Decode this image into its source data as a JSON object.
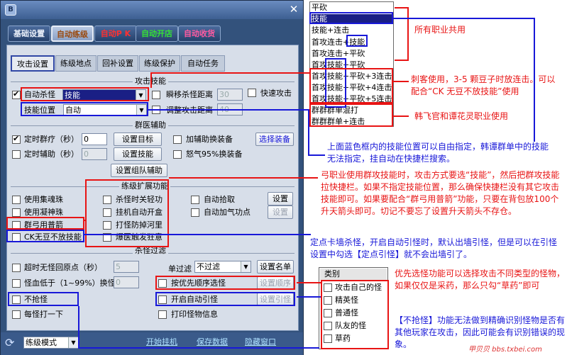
{
  "window": {
    "close_icon": "✕",
    "app_icon": "B"
  },
  "nav": [
    "基础设置",
    "自动练级",
    "自动P K",
    "自动开店",
    "自动收货"
  ],
  "nav_colors": [
    "#e8eef8",
    "#f0b060",
    "#ff3030",
    "#35e035",
    "#ff5aa0"
  ],
  "subtabs": [
    "攻击设置",
    "练级地点",
    "回补设置",
    "练级保护",
    "自动任务"
  ],
  "sections": {
    "attack_skill": "攻击技能",
    "group_assist": "群医辅助",
    "leveling_ext": "练级扩展功能",
    "monster_filter": "杀怪过滤"
  },
  "attack": {
    "auto_kill": "自动杀怪",
    "skill_value": "技能",
    "skill_position": "技能位置",
    "position_value": "自动",
    "shift_dist": "瞬移杀怪距离",
    "shift_dist_value": "30",
    "quick_attack": "快速攻击",
    "adjust_dist": "调整攻击距离",
    "adjust_dist_value": "40"
  },
  "group": {
    "timed_group": "定时群疗（秒）",
    "timed_group_value": "0",
    "set_target": "设置目标",
    "add_aux": "加辅助换装备",
    "select_equip": "选择装备",
    "timed_aux": "定时辅助（秒）",
    "timed_aux_value": "0",
    "set_skill": "设置技能",
    "rage": "怒气95%换装备",
    "set_party_aux": "设置组队辅助"
  },
  "ext": {
    "use_soul": "使用集魂珠",
    "kill_skill": "杀怪时关轻功",
    "auto_pick": "自动拾取",
    "settings": "设置",
    "use_ning": "使用凝神珠",
    "auto_gold": "挂机自动开盒",
    "auto_points": "自动加气功点",
    "settings2": "设置",
    "group_arrow": "群弓用普箭",
    "fight_river": "打怪防掉河里",
    "ck_skill": "CK无豆不放技能",
    "rage_burst": "爆医触发狂意"
  },
  "filter": {
    "timeout_return": "超时无怪回原点（秒）",
    "timeout_value": "5",
    "name_filter": "单过滤",
    "filter_value": "不过滤",
    "set_names": "设置名单",
    "hp_low": "怪血低于（1~99%）换怪",
    "hp_low_value": "0",
    "priority_select": "按优先顺序选怪",
    "set_order": "设置顺序",
    "no_pick": "不抢怪",
    "auto_lure": "开启自动引怪",
    "set_lure": "设置引怪",
    "each_hit": "每怪打一下",
    "print_info": "打印怪物信息"
  },
  "bottom": {
    "mode": "练级模式",
    "start": "开始挂机",
    "save": "保存数据",
    "hide": "隐藏窗口"
  },
  "skill_list": [
    "平砍",
    "技能",
    "技能+连击",
    "首攻连击+技能",
    "首攻连击+平砍",
    "首攻技能+平砍",
    "首攻技能+平砍+3连击",
    "首攻技能+平砍+4连击",
    "首攻技能+平砍+5连击",
    "群群群单混打",
    "群群群单+连击"
  ],
  "monster_list": {
    "header": "类别",
    "items": [
      "攻击自己的怪",
      "精英怪",
      "普通怪",
      "队友的怪",
      "草药"
    ]
  },
  "notes": {
    "all_classes": "所有职业共用",
    "assassin": "刺客使用，3-5 颗豆子时放连击。可以配合“CK 无豆不放技能”使用",
    "han_tan": "韩飞官和谭花灵职业使用",
    "blue_box": "上面蓝色框内的技能位置可以自由指定，韩谭群单中的技能无法指定，挂自动在快捷栏搜索。",
    "bow": "弓职业使用群攻技能时，攻击方式要选“技能”，然后把群攻技能拉快捷栏。如果不指定技能位置，那么确保快捷栏没有其它攻击技能即可。如果要配合“群弓用普箭”功能，只要在背包放100个升天箭头即可。切记不要忘了设置升天箭头不存仓。",
    "lure": "定点卡墙杀怪，开启自动引怪时，默认出墙引怪，但是可以在引怪设置中勾选【定点引怪】就不会出墙引了。",
    "priority": "优先选怪功能可以选择攻击不同类型的怪物，如果仅仅是采药，那么只勾“草药”即可",
    "no_pick": "【不抢怪】功能无法做到精确识别怪物是否有其他玩家在攻击，因此可能会有识别错误的现象。"
  },
  "watermark": "甲贝贝 bbs.txbei.com"
}
